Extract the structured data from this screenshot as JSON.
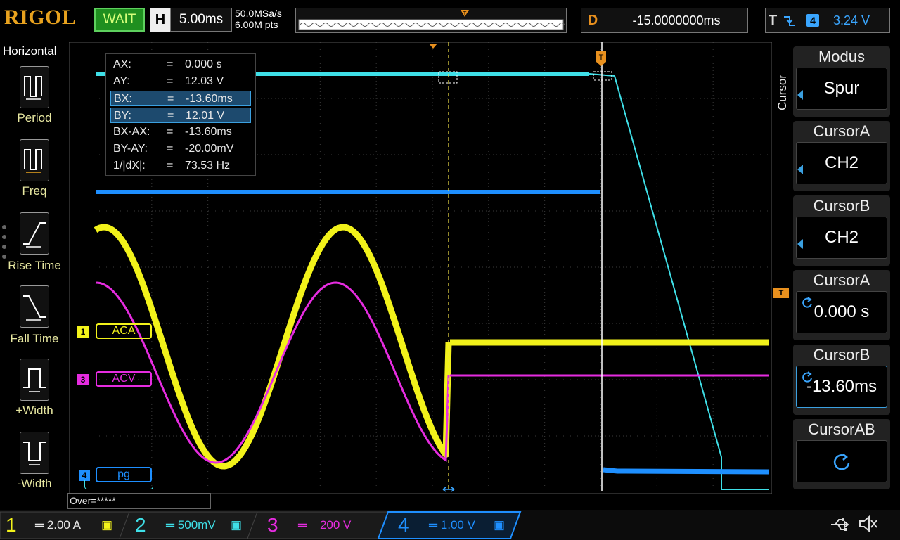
{
  "brand": "RIGOL",
  "status": "WAIT",
  "horizontal": {
    "key": "H",
    "timebase": "5.00ms",
    "sample_rate": "50.0MSa/s",
    "memory_depth": "6.00M pts"
  },
  "delay": {
    "key": "D",
    "value": "-15.0000000ms"
  },
  "trigger": {
    "key": "T",
    "channel": "4",
    "level": "3.24 V"
  },
  "left_menu": {
    "title": "Horizontal",
    "items": [
      {
        "label": "Period",
        "icon": "period-icon"
      },
      {
        "label": "Freq",
        "icon": "frequency-icon"
      },
      {
        "label": "Rise Time",
        "icon": "rise-time-icon"
      },
      {
        "label": "Fall Time",
        "icon": "fall-time-icon"
      },
      {
        "label": "+Width",
        "icon": "positive-width-icon"
      },
      {
        "label": "-Width",
        "icon": "negative-width-icon"
      }
    ]
  },
  "cursor_readout": [
    {
      "key": "AX:",
      "eq": "=",
      "value": "0.000 s",
      "selected": false
    },
    {
      "key": "AY:",
      "eq": "=",
      "value": "12.03 V",
      "selected": false
    },
    {
      "key": "BX:",
      "eq": "=",
      "value": "-13.60ms",
      "selected": true
    },
    {
      "key": "BY:",
      "eq": "=",
      "value": "12.01 V",
      "selected": true
    },
    {
      "key": "BX-AX:",
      "eq": "=",
      "value": "-13.60ms",
      "selected": false
    },
    {
      "key": "BY-AY:",
      "eq": "=",
      "value": "-20.00mV",
      "selected": false
    },
    {
      "key": "1/|dX|:",
      "eq": "=",
      "value": "73.53 Hz",
      "selected": false
    }
  ],
  "channel_tags": {
    "ch1": {
      "num": "1",
      "label": "ACA",
      "color": "#f2f21a"
    },
    "ch3": {
      "num": "3",
      "label": "ACV",
      "color": "#e62ce0"
    },
    "ch4": {
      "num": "4",
      "label": "pg",
      "color": "#1e8fff"
    }
  },
  "right_menu": {
    "section": "Cursor",
    "panels": [
      {
        "title": "Modus",
        "value": "Spur"
      },
      {
        "title": "CursorA",
        "value": "CH2"
      },
      {
        "title": "CursorB",
        "value": "CH2"
      },
      {
        "title": "CursorA",
        "value": "0.000 s"
      },
      {
        "title": "CursorB",
        "value": "-13.60ms"
      },
      {
        "title": "CursorAB",
        "value": ""
      }
    ]
  },
  "over_text": "Over=*****",
  "channels_bottom": [
    {
      "num": "1",
      "scale": "2.00 A",
      "color": "#f2f21a"
    },
    {
      "num": "2",
      "scale": "500mV",
      "color": "#3fe0e8"
    },
    {
      "num": "3",
      "scale": "200 V",
      "color": "#e62ce0"
    },
    {
      "num": "4",
      "scale": "1.00 V",
      "color": "#1e8fff"
    }
  ],
  "colors": {
    "ch1": "#f2f21a",
    "ch2": "#3fe0e8",
    "ch3": "#e62ce0",
    "ch4": "#1e8fff",
    "trigger_marker": "#e8901e",
    "status_green": "#1f8f1f"
  }
}
